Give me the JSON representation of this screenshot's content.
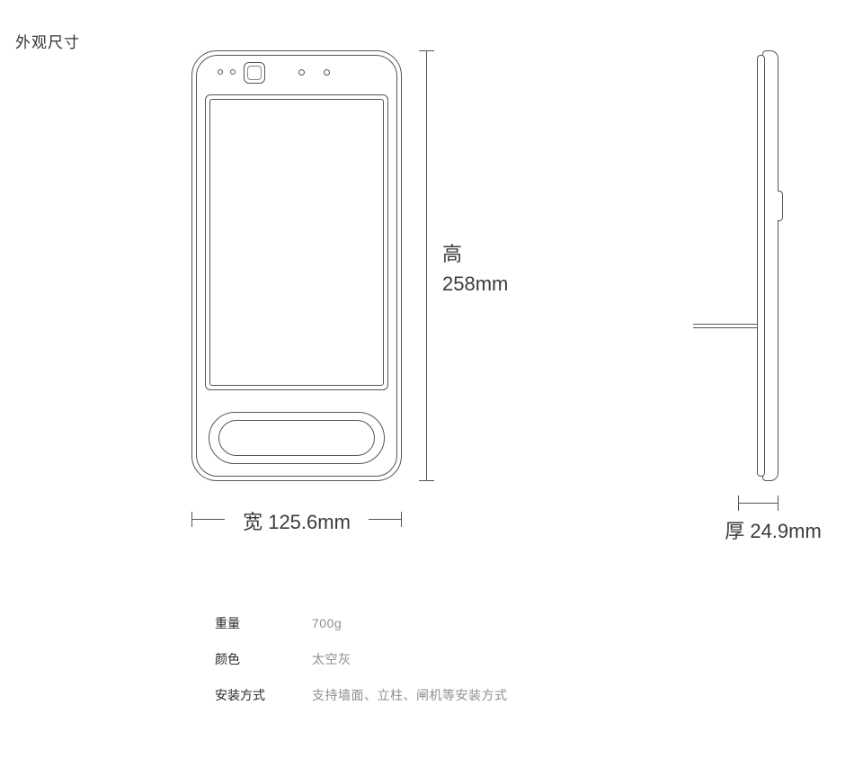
{
  "section_title": "外观尺寸",
  "dimensions": {
    "height": {
      "label": "高",
      "value": "258mm"
    },
    "width": {
      "label": "宽",
      "value": "125.6mm"
    },
    "depth": {
      "label": "厚",
      "value": "24.9mm"
    }
  },
  "specs": [
    {
      "label": "重量",
      "value": "700g"
    },
    {
      "label": "颜色",
      "value": "太空灰"
    },
    {
      "label": "安装方式",
      "value": "支持墙面、立柱、闸机等安装方式"
    }
  ]
}
